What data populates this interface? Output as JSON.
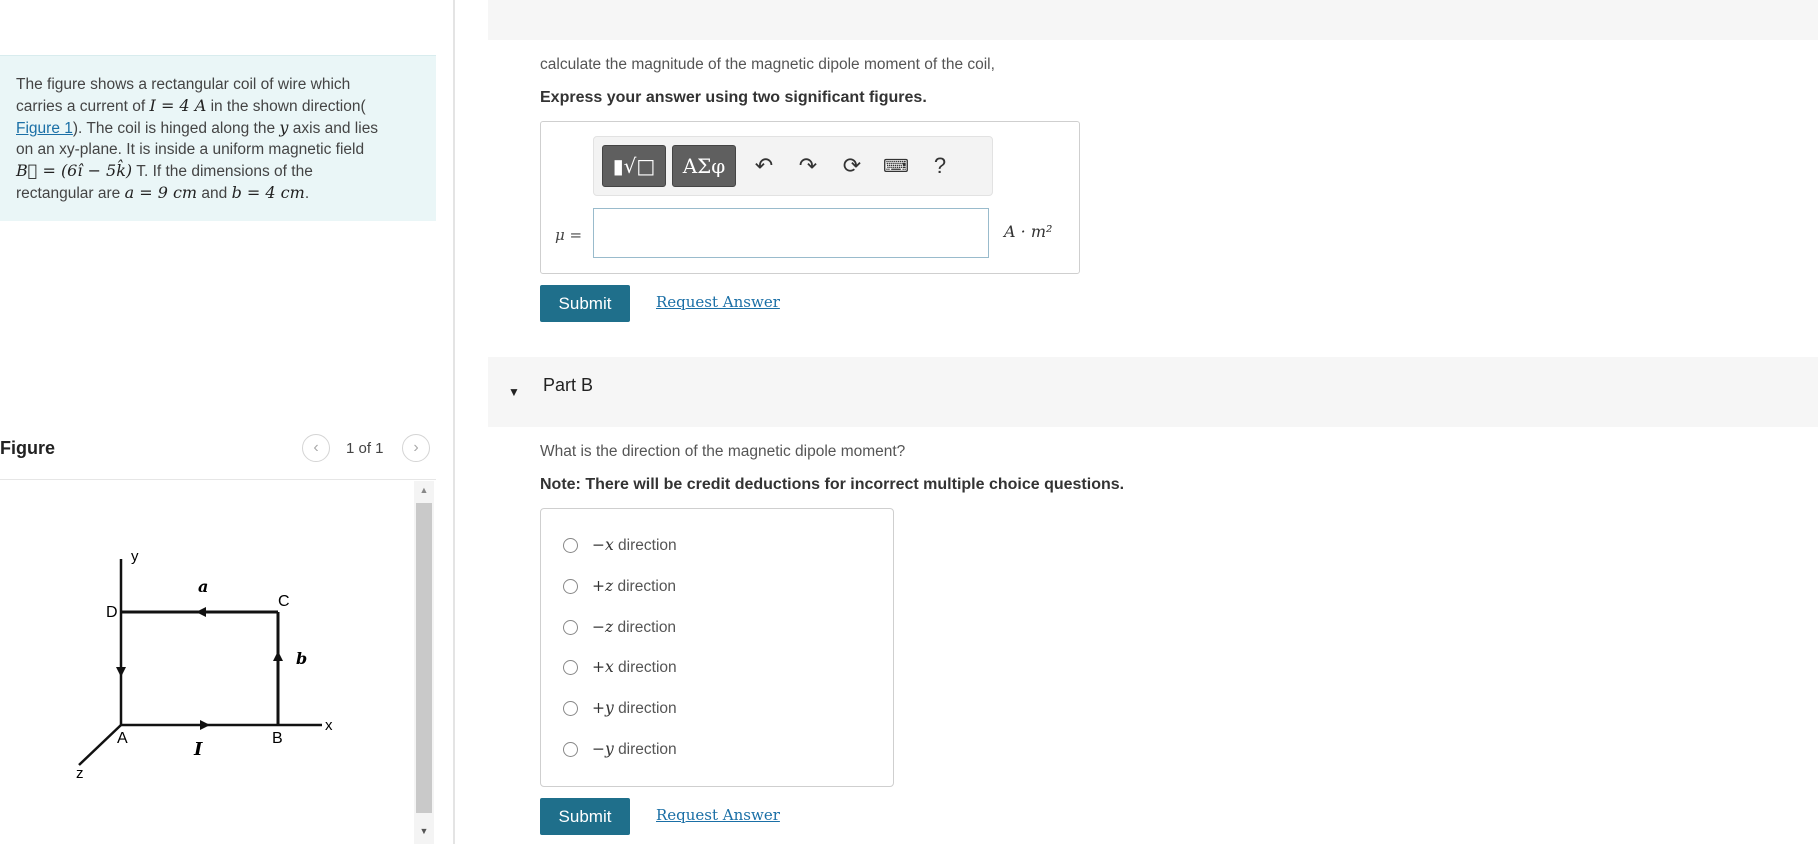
{
  "problem": {
    "t1": "The figure shows a rectangular coil of wire which",
    "t2a": "carries a current of",
    "current_math": "I = 4 A",
    "t2b": "in the shown direction(",
    "figure_link": "Figure 1",
    "t3": "). The coil is hinged along the",
    "yvar": "y",
    "t3b": "axis and lies",
    "t4": "on an xy-plane. It is inside a uniform magnetic field",
    "field_math": "B⃗ = (6î − 5k̂)",
    "t5": "T. If the dimensions of the",
    "t6": "rectangular are",
    "dim_a": "a = 9 cm",
    "and": "and",
    "dim_b": "b = 4 cm",
    "end": "."
  },
  "figure": {
    "title": "Figure",
    "counter": "1 of 1",
    "labels": {
      "y": "y",
      "x": "x",
      "z": "z",
      "A": "A",
      "B": "B",
      "C": "C",
      "D": "D",
      "a": "a",
      "b": "b",
      "I": "I"
    }
  },
  "partA": {
    "question": "calculate the magnitude of the magnetic dipole moment of the coil,",
    "instruction": "Express your answer using two significant figures.",
    "greek_label": "ΑΣφ",
    "help": "?",
    "answer_label": "μ =",
    "answer_value": "",
    "unit": "A · m²",
    "submit": "Submit",
    "request": "Request Answer"
  },
  "partB": {
    "title": "Part B",
    "question": "What is the direction of the magnetic dipole moment?",
    "note": "Note: There will be credit deductions for incorrect multiple choice questions.",
    "choices": [
      {
        "sym": "−x",
        "text": "direction"
      },
      {
        "sym": "+z",
        "text": "direction"
      },
      {
        "sym": "−z",
        "text": "direction"
      },
      {
        "sym": "+x",
        "text": "direction"
      },
      {
        "sym": "+y",
        "text": "direction"
      },
      {
        "sym": "−y",
        "text": "direction"
      }
    ],
    "submit": "Submit",
    "request": "Request Answer"
  }
}
